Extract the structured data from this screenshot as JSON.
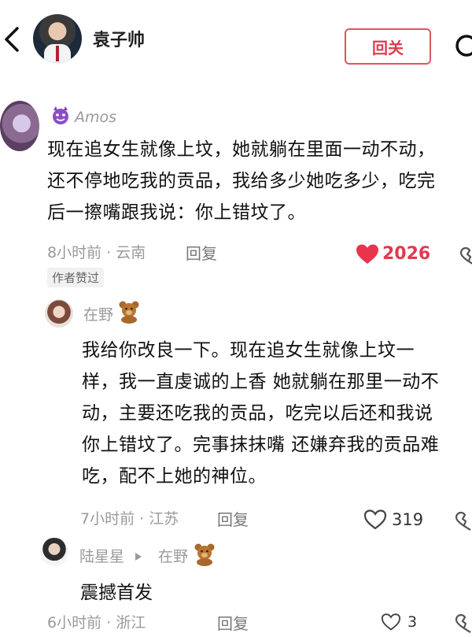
{
  "header": {
    "author_name": "袁子帅",
    "follow_label": "回关"
  },
  "comments": [
    {
      "user": "Amos",
      "text_lines": [
        "现在追女生就像上坟，她就躺在里面一动不动，",
        "还不停地吃我的贡品，我给多少她吃多少，吃完",
        "后一擦嘴跟我说：你上错坟了。"
      ],
      "time_location": "8小时前 · 云南",
      "reply_label": "回复",
      "likes": "2026",
      "author_liked": "作者赞过"
    },
    {
      "user": "在野",
      "text_lines": [
        "我给你改良一下。现在追女生就像上坟一",
        "样，我一直虔诚的上香 她就躺在那里一动不",
        "动，主要还吃我的贡品，吃完以后还和我说",
        "你上错坟了。完事抹抹嘴 还嫌弃我的贡品难",
        "吃，配不上她的神位。"
      ],
      "time_location": "7小时前 · 江苏",
      "reply_label": "回复",
      "likes": "319"
    },
    {
      "user": "陆星星",
      "reply_to": "在野",
      "text": "震撼首发",
      "time_location": "6小时前 · 浙江",
      "reply_label": "回复",
      "likes": "3"
    }
  ],
  "icons": {
    "back": "chevron-left-icon",
    "share": "refresh-icon",
    "like_active": "heart-filled-icon",
    "like": "heart-outline-icon",
    "dislike": "broken-heart-icon",
    "badge": "devil-emoji-icon",
    "bear": "teddy-bear-emoji-icon"
  },
  "colors": {
    "accent": "#e03a4d",
    "muted_text": "#9a9a9a"
  }
}
